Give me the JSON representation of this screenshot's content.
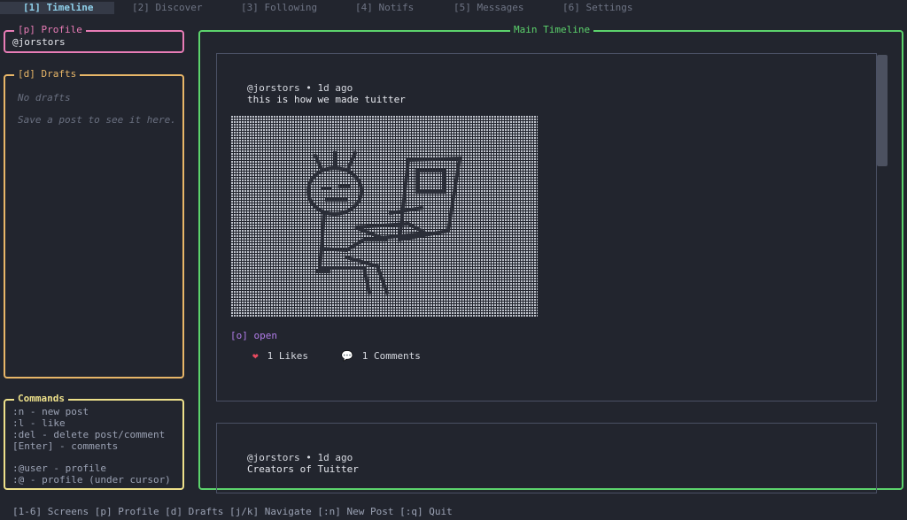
{
  "tabs": [
    {
      "label": "[1] Timeline",
      "active": true
    },
    {
      "label": "[2] Discover",
      "active": false
    },
    {
      "label": "[3] Following",
      "active": false
    },
    {
      "label": "[4] Notifs",
      "active": false
    },
    {
      "label": "[5] Messages",
      "active": false
    },
    {
      "label": "[6] Settings",
      "active": false
    }
  ],
  "profile": {
    "title": "[p] Profile",
    "handle": "@jorstors"
  },
  "drafts": {
    "title": "[d] Drafts",
    "empty": "No drafts",
    "hint": "Save a post to see it here."
  },
  "commands": {
    "title": "Commands",
    "lines": [
      ":n - new post",
      ":l - like",
      ":del - delete post/comment",
      "[Enter] - comments",
      "",
      ":@user - profile",
      ":@ - profile (under cursor)"
    ]
  },
  "main": {
    "title": "Main Timeline",
    "posts": [
      {
        "meta": "@jorstors • 1d ago",
        "text": "this is how we made tuitter",
        "open": "[o] open",
        "likes": "1 Likes",
        "comments": "1 Comments",
        "heart_icon": "❤",
        "comment_icon": "💬"
      },
      {
        "meta": "@jorstors • 1d ago",
        "text": "Creators of Tuitter"
      }
    ]
  },
  "statusbar": {
    "text": "[1-6] Screens [p] Profile [d] Drafts [j/k] Navigate [:n] New Post [:q] Quit"
  },
  "colors": {
    "background": "#22252e",
    "profile": "#e87cb6",
    "drafts": "#e8b668",
    "commands": "#ede08a",
    "main": "#5cd36c",
    "active_tab": "#8fd0ea",
    "open_link": "#b07ce8",
    "heart": "#e84a5f"
  }
}
